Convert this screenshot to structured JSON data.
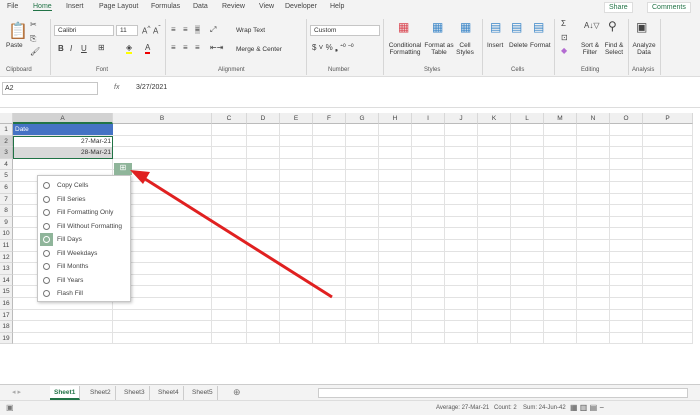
{
  "menu_tabs": [
    "File",
    "Home",
    "Insert",
    "Page Layout",
    "Formulas",
    "Data",
    "Review",
    "View",
    "Developer",
    "Help"
  ],
  "active_tab": "Home",
  "share": "Share",
  "comments": "Comments",
  "ribbon": {
    "paste": "Paste",
    "font_name": "Calibri",
    "font_size": "11",
    "wrap_text": "Wrap Text",
    "merge_center": "Merge & Center",
    "number_format": "Custom",
    "conditional": "Conditional Formatting",
    "format_table": "Format as Table",
    "cell_styles": "Cell Styles",
    "insert": "Insert",
    "delete": "Delete",
    "format": "Format",
    "sort_filter": "Sort & Filter",
    "find_select": "Find & Select",
    "analyze": "Analyze Data",
    "groups": [
      "Clipboard",
      "Font",
      "Alignment",
      "Number",
      "Styles",
      "Cells",
      "Editing",
      "Analysis"
    ]
  },
  "name_box": "A2",
  "fx": "fx",
  "formula": "3/27/2021",
  "columns": [
    "A",
    "B",
    "C",
    "D",
    "E",
    "F",
    "G",
    "H",
    "I",
    "J",
    "K",
    "L",
    "M",
    "N",
    "O",
    "P"
  ],
  "rows": [
    "1",
    "2",
    "3",
    "4",
    "5",
    "6",
    "7",
    "8",
    "9",
    "10",
    "11",
    "12",
    "13",
    "14",
    "15",
    "16",
    "17",
    "18",
    "19"
  ],
  "cells": {
    "A1": "Date",
    "A2": "27-Mar-21",
    "A3": "28-Mar-21"
  },
  "autofill_menu": {
    "items": [
      "Copy Cells",
      "Fill Series",
      "Fill Formatting Only",
      "Fill Without Formatting",
      "Fill Days",
      "Fill Weekdays",
      "Fill Months",
      "Fill Years",
      "Flash Fill"
    ],
    "selected": "Fill Days"
  },
  "sheets": [
    "Sheet1",
    "Sheet2",
    "Sheet3",
    "Sheet4",
    "Sheet5"
  ],
  "active_sheet": "Sheet1",
  "status": {
    "average": "Average: 27-Mar-21",
    "count": "Count: 2",
    "sum": "Sum: 24-Jun-42"
  },
  "colors": {
    "accent": "#217346",
    "header_fill": "#4472c4",
    "selection": "#d9d9d9",
    "arrow": "#e02020"
  }
}
